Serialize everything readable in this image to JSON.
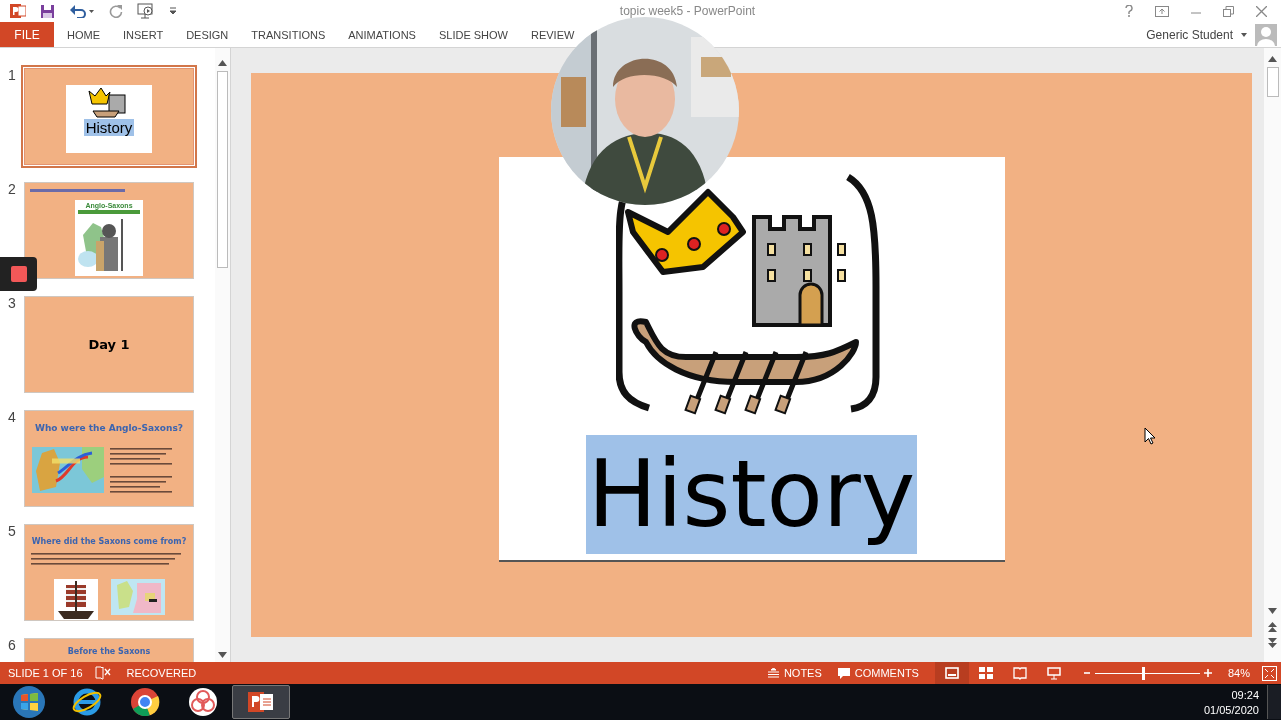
{
  "window": {
    "title": "topic week5 - PowerPoint"
  },
  "ribbon": {
    "file_tab": "FILE",
    "tabs": [
      {
        "label": "HOME"
      },
      {
        "label": "INSERT"
      },
      {
        "label": "DESIGN"
      },
      {
        "label": "TRANSITIONS"
      },
      {
        "label": "ANIMATIONS"
      },
      {
        "label": "SLIDE SHOW"
      },
      {
        "label": "REVIEW"
      }
    ],
    "account": "Generic Student"
  },
  "thumbnails": [
    {
      "number": "1",
      "kind": "title-image",
      "title": "History",
      "selected": true
    },
    {
      "number": "2",
      "kind": "cover-image",
      "title": "Anglo-Saxons",
      "selected": false
    },
    {
      "number": "3",
      "kind": "text",
      "title": "Day 1",
      "selected": false
    },
    {
      "number": "4",
      "kind": "map-bullets",
      "title": "Who were the Anglo-Saxons?",
      "selected": false
    },
    {
      "number": "5",
      "kind": "two-images",
      "title": "Where did the Saxons come from?",
      "selected": false
    },
    {
      "number": "6",
      "kind": "title-only",
      "title": "Before the Saxons",
      "selected": false
    }
  ],
  "slide": {
    "caption": "History"
  },
  "status_bar": {
    "slide_position": "SLIDE 1 OF 16",
    "state": "RECOVERED",
    "notes": "NOTES",
    "comments": "COMMENTS",
    "views": [
      {
        "kind": "normal",
        "selected": true
      },
      {
        "kind": "sorter",
        "selected": false
      },
      {
        "kind": "reading",
        "selected": false
      },
      {
        "kind": "slideshow",
        "selected": false
      }
    ],
    "zoom": {
      "level": 0.46,
      "reading": "84%"
    }
  },
  "taskbar": {
    "apps": [
      {
        "kind": "start",
        "selected": false
      },
      {
        "kind": "browser-e",
        "selected": false
      },
      {
        "kind": "browser-ring",
        "selected": false
      },
      {
        "kind": "swirl",
        "selected": false
      },
      {
        "kind": "slides",
        "selected": true
      }
    ],
    "time": "09:24",
    "date": "01/05/2020"
  }
}
